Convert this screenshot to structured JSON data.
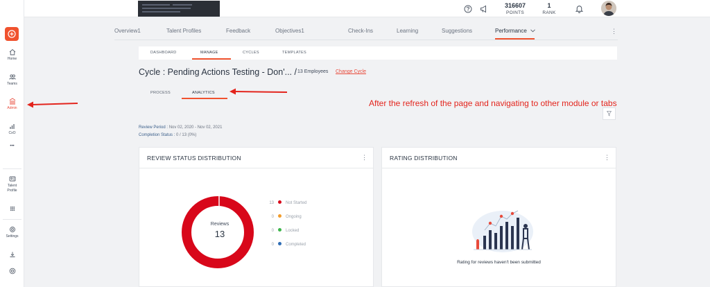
{
  "topbar": {
    "points_value": "316607",
    "points_label": "POINTS",
    "rank_value": "1",
    "rank_label": "RANK"
  },
  "sidebar": {
    "items": [
      {
        "label": "Home",
        "icon": "home-icon"
      },
      {
        "label": "Teams",
        "icon": "teams-icon"
      },
      {
        "label": "Admin",
        "icon": "admin-icon"
      },
      {
        "label": "CxO",
        "icon": "chart-icon"
      },
      {
        "label": "•••",
        "icon": "more-icon"
      },
      {
        "label": "Talent Profile",
        "icon": "profile-card-icon"
      },
      {
        "label": "",
        "icon": "grid-icon"
      },
      {
        "label": "Settings",
        "icon": "settings-icon"
      },
      {
        "label": "",
        "icon": "download-icon"
      },
      {
        "label": "",
        "icon": "help-icon"
      }
    ]
  },
  "nav": {
    "tabs": [
      "Overview1",
      "Talent Profiles",
      "Feedback",
      "Objectives1",
      "Check-Ins",
      "Learning",
      "Suggestions",
      "Performance"
    ],
    "active": "Performance"
  },
  "subtabs": [
    "DASHBOARD",
    "MANAGE",
    "CYCLES",
    "TEMPLATES"
  ],
  "subtabs_active": "MANAGE",
  "cycle": {
    "title": "Cycle : Pending Actions Testing - Don'... /",
    "employees": "13 Employees",
    "change_link": "Change Cycle"
  },
  "view_tabs": [
    "PROCESS",
    "ANALYTICS"
  ],
  "view_tabs_active": "ANALYTICS",
  "annotation": "After the refresh of the page and navigating to other module or tabs",
  "meta": {
    "review_period_label": "Review Period :",
    "review_period_value": "Nov 02, 2020 - Nov 02, 2021",
    "completion_label": "Completion Status :",
    "completion_value": "0 / 13 (0%)"
  },
  "review_card": {
    "title": "REVIEW STATUS DISTRIBUTION",
    "center_label": "Reviews",
    "center_value": "13",
    "legend": [
      {
        "count": "13",
        "label": "Not Started",
        "color": "#d8071a"
      },
      {
        "count": "0",
        "label": "Ongoing",
        "color": "#f29c2b"
      },
      {
        "count": "0",
        "label": "Locked",
        "color": "#3cb54a"
      },
      {
        "count": "0",
        "label": "Completed",
        "color": "#2f6db5"
      }
    ]
  },
  "rating_card": {
    "title": "RATING DISTRIBUTION",
    "empty_message": "Rating for reviews haven't been submitted"
  },
  "colors": {
    "accent": "#f0522e",
    "annotation_red": "#e3241c",
    "donut_red": "#d8071a"
  }
}
